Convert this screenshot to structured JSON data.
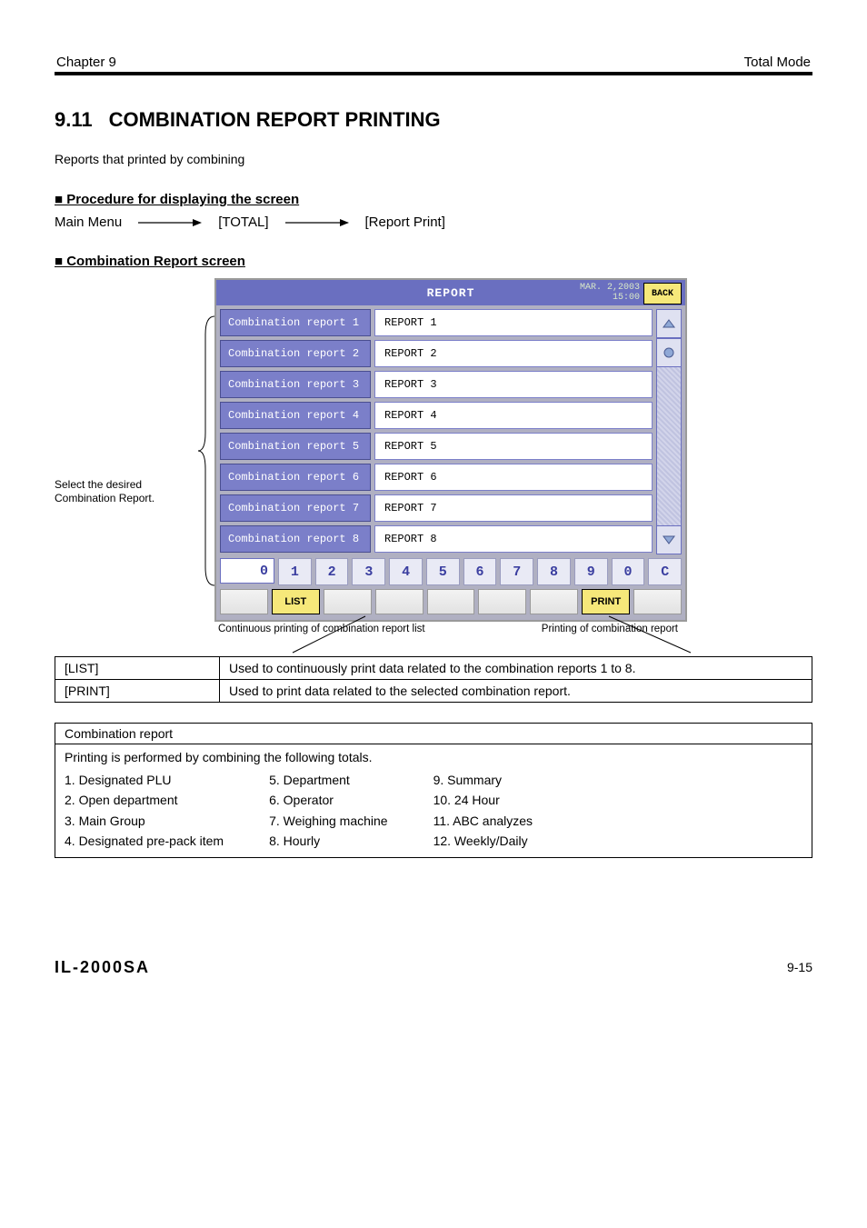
{
  "chapter": {
    "left": "Chapter 9",
    "right": "Total Mode"
  },
  "section": {
    "number": "9.11",
    "title": "COMBINATION REPORT PRINTING"
  },
  "intro": "Reports that printed by combining",
  "procedure": {
    "label": "■ Procedure for displaying the screen",
    "step1": "Main Menu",
    "step2": "[TOTAL]",
    "step3": "[Report Print]"
  },
  "screen_label": "■ Combination Report screen",
  "left_caption": "Select the desired Combination Report.",
  "screenshot": {
    "title": "REPORT",
    "date_line1": "MAR. 2,2003",
    "date_line2": "15:00",
    "back_label": "BACK",
    "rows": [
      {
        "label": "Combination report 1",
        "value": "REPORT 1"
      },
      {
        "label": "Combination report 2",
        "value": "REPORT 2"
      },
      {
        "label": "Combination report 3",
        "value": "REPORT 3"
      },
      {
        "label": "Combination report 4",
        "value": "REPORT 4"
      },
      {
        "label": "Combination report 5",
        "value": "REPORT 5"
      },
      {
        "label": "Combination report 6",
        "value": "REPORT 6"
      },
      {
        "label": "Combination report 7",
        "value": "REPORT 7"
      },
      {
        "label": "Combination report 8",
        "value": "REPORT 8"
      }
    ],
    "numpad_display": "0",
    "numpad_keys": [
      "1",
      "2",
      "3",
      "4",
      "5",
      "6",
      "7",
      "8",
      "9",
      "0",
      "C"
    ],
    "list_btn": "LIST",
    "print_btn": "PRINT"
  },
  "under": {
    "left": "Continuous printing of combination report list",
    "right": "Printing of combination report"
  },
  "table": [
    {
      "k": "[LIST]",
      "v": "Used to continuously print data related to the combination reports 1 to 8."
    },
    {
      "k": "[PRINT]",
      "v": "Used to print data related to the selected combination report."
    }
  ],
  "combo": {
    "head": "Combination report",
    "lead": "Printing is performed by combining the following totals.",
    "col1": [
      "1. Designated PLU",
      "2. Open department",
      "3. Main Group",
      "4. Designated pre-pack item"
    ],
    "col2": [
      "5. Department",
      "6. Operator",
      "7. Weighing machine",
      "8. Hourly"
    ],
    "col3": [
      "9. Summary",
      "10. 24 Hour",
      "11. ABC analyzes",
      "12. Weekly/Daily"
    ]
  },
  "footer": {
    "model": "IL-2000SA",
    "page": "9-15"
  }
}
